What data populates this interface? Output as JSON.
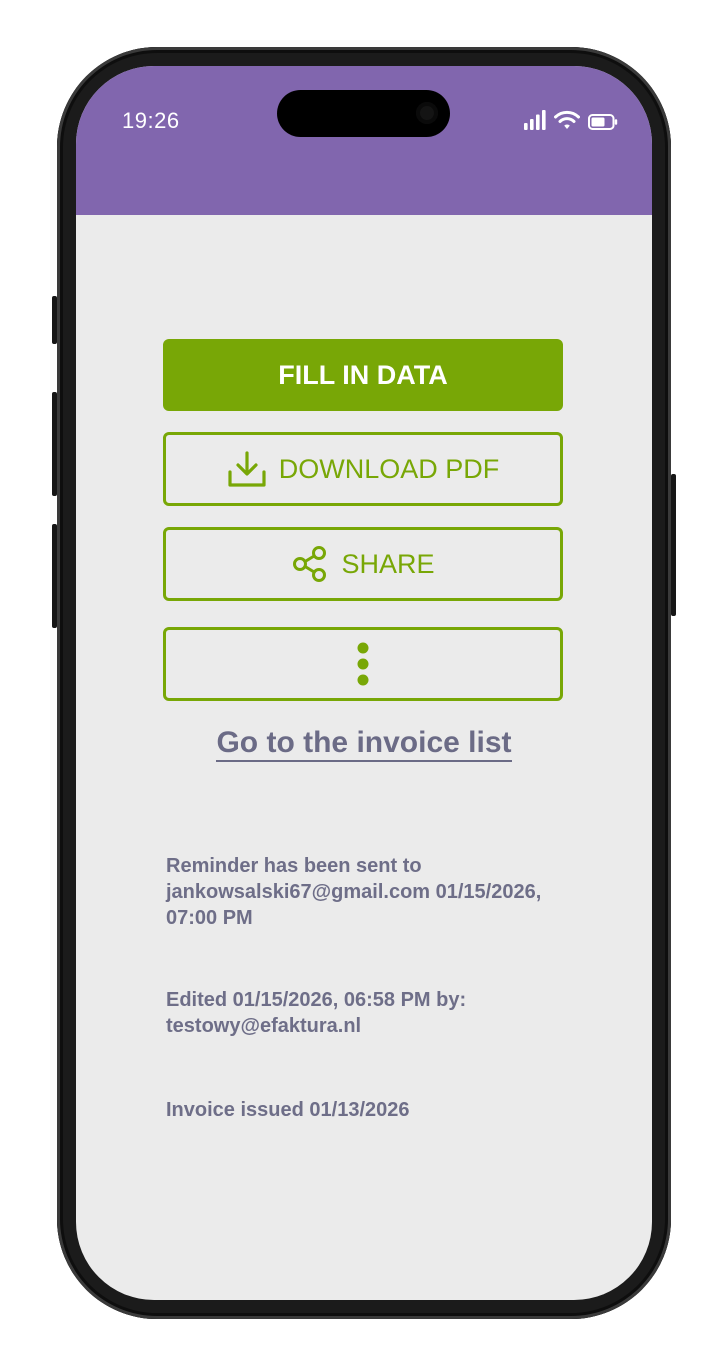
{
  "status_bar": {
    "time": "19:26",
    "icons": [
      "cellular-signal-icon",
      "wifi-icon",
      "battery-icon"
    ]
  },
  "colors": {
    "header": "#8166ae",
    "accent": "#78a706",
    "background": "#ebebeb",
    "muted_text": "#6e6e88"
  },
  "actions": {
    "fill_in_data": "FILL IN DATA",
    "download_pdf": "DOWNLOAD PDF",
    "download_icon": "download-icon",
    "share": "SHARE",
    "share_icon": "share-icon",
    "more_icon": "more-vertical-icon"
  },
  "invoice_list_link": "Go to the invoice list",
  "history": [
    "Reminder has been sent to jankowsalski67@gmail.com 01/15/2026, 07:00 PM",
    "Edited 01/15/2026, 06:58 PM by: testowy@efaktura.nl",
    "Invoice issued 01/13/2026"
  ]
}
